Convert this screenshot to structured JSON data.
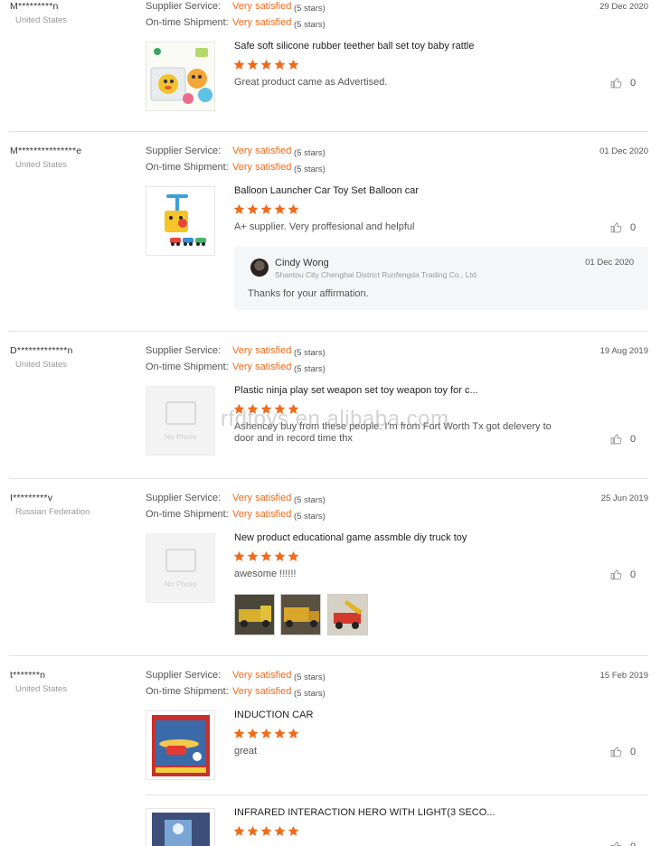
{
  "labels": {
    "supplier_service": "Supplier Service:",
    "ontime_shipment": "On-time Shipment:",
    "no_photo": "No Photo"
  },
  "accent_color": "#f06b1b",
  "watermark": "rfdtoys.en.alibaba.com",
  "reviews": [
    {
      "buyer": "M*********n",
      "country": "United States",
      "date": "29 Dec 2020",
      "supplier_service": "Very satisfied",
      "supplier_stars": "(5 stars)",
      "ontime_shipment": "Very satisfied",
      "shipment_stars": "(5 stars)",
      "product": "Safe soft silicone rubber teether ball set toy baby rattle",
      "rating": 5,
      "comment": "Great product came as Advertised.",
      "likes": "0"
    },
    {
      "buyer": "M***************e",
      "country": "United States",
      "date": "01 Dec 2020",
      "supplier_service": "Very satisfied",
      "supplier_stars": "(5 stars)",
      "ontime_shipment": "Very satisfied",
      "shipment_stars": "(5 stars)",
      "product": "Balloon Launcher Car Toy Set Balloon car",
      "rating": 5,
      "comment": "A+ supplier. Very proffesional and helpful",
      "likes": "0",
      "reply": {
        "name": "Cindy Wong",
        "company": "Shantou City Chenghai District Runfengda Trading Co., Ltd.",
        "date": "01 Dec 2020",
        "text": "Thanks for your affirmation."
      }
    },
    {
      "buyer": "D*************n",
      "country": "United States",
      "date": "19 Aug 2019",
      "supplier_service": "Very satisfied",
      "supplier_stars": "(5 stars)",
      "ontime_shipment": "Very satisfied",
      "shipment_stars": "(5 stars)",
      "product": "Plastic ninja play set weapon set toy weapon toy for c...",
      "rating": 5,
      "comment": "Ashencey buy from these people. I'm from Fort Worth Tx got delevery to door and in record time thx",
      "likes": "0"
    },
    {
      "buyer": "I*********v",
      "country": "Russian Federation",
      "date": "25 Jun 2019",
      "supplier_service": "Very satisfied",
      "supplier_stars": "(5 stars)",
      "ontime_shipment": "Very satisfied",
      "shipment_stars": "(5 stars)",
      "product": "New product educational game assmble diy truck toy",
      "rating": 5,
      "comment": "awesome !!!!!!",
      "likes": "0"
    },
    {
      "buyer": "t*******n",
      "country": "United States",
      "date": "15 Feb 2019",
      "supplier_service": "Very satisfied",
      "supplier_stars": "(5 stars)",
      "ontime_shipment": "Very satisfied",
      "shipment_stars": "(5 stars)",
      "product": "INDUCTION CAR",
      "rating": 5,
      "comment": "great",
      "likes": "0"
    }
  ],
  "extra_item": {
    "product": "INFRARED INTERACTION HERO WITH LIGHT(3 SECO...",
    "rating": 5,
    "likes": "0"
  }
}
